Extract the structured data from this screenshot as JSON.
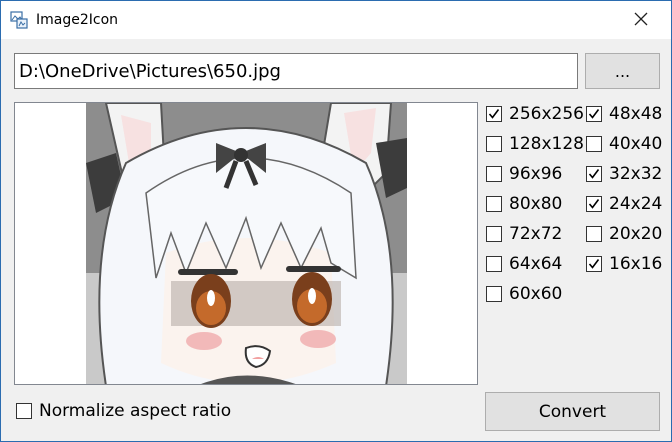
{
  "window": {
    "title": "Image2Icon",
    "app_icon": "image-convert-icon",
    "close_icon": "close-icon"
  },
  "file": {
    "path": "D:\\OneDrive\\Pictures\\650.jpg",
    "browse_label": "..."
  },
  "preview": {
    "image_subject": "anime-girl-with-fox-ears"
  },
  "sizes": {
    "items": [
      {
        "label": "256x256",
        "checked": true
      },
      {
        "label": "48x48",
        "checked": true
      },
      {
        "label": "128x128",
        "checked": false
      },
      {
        "label": "40x40",
        "checked": false
      },
      {
        "label": "96x96",
        "checked": false
      },
      {
        "label": "32x32",
        "checked": true
      },
      {
        "label": "80x80",
        "checked": false
      },
      {
        "label": "24x24",
        "checked": true
      },
      {
        "label": "72x72",
        "checked": false
      },
      {
        "label": "20x20",
        "checked": false
      },
      {
        "label": "64x64",
        "checked": false
      },
      {
        "label": "16x16",
        "checked": true
      },
      {
        "label": "60x60",
        "checked": false
      }
    ]
  },
  "options": {
    "normalize_label": "Normalize aspect ratio",
    "normalize_checked": false
  },
  "actions": {
    "convert_label": "Convert"
  },
  "colors": {
    "window_border": "#2b6cb0",
    "button_face": "#e1e1e1",
    "background": "#f0f0f0"
  }
}
